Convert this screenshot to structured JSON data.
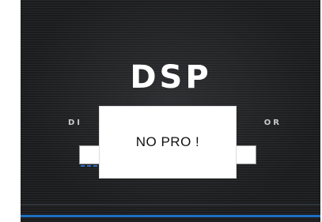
{
  "app": {
    "logo_text": "DSP",
    "subtitle_left": "DI",
    "subtitle_right": "OR"
  },
  "dialog": {
    "message": "NO PRO !"
  },
  "colors": {
    "background": "#1a1b1d",
    "accent_blue": "#1d6fc1",
    "dialog_bg": "#ffffff"
  }
}
